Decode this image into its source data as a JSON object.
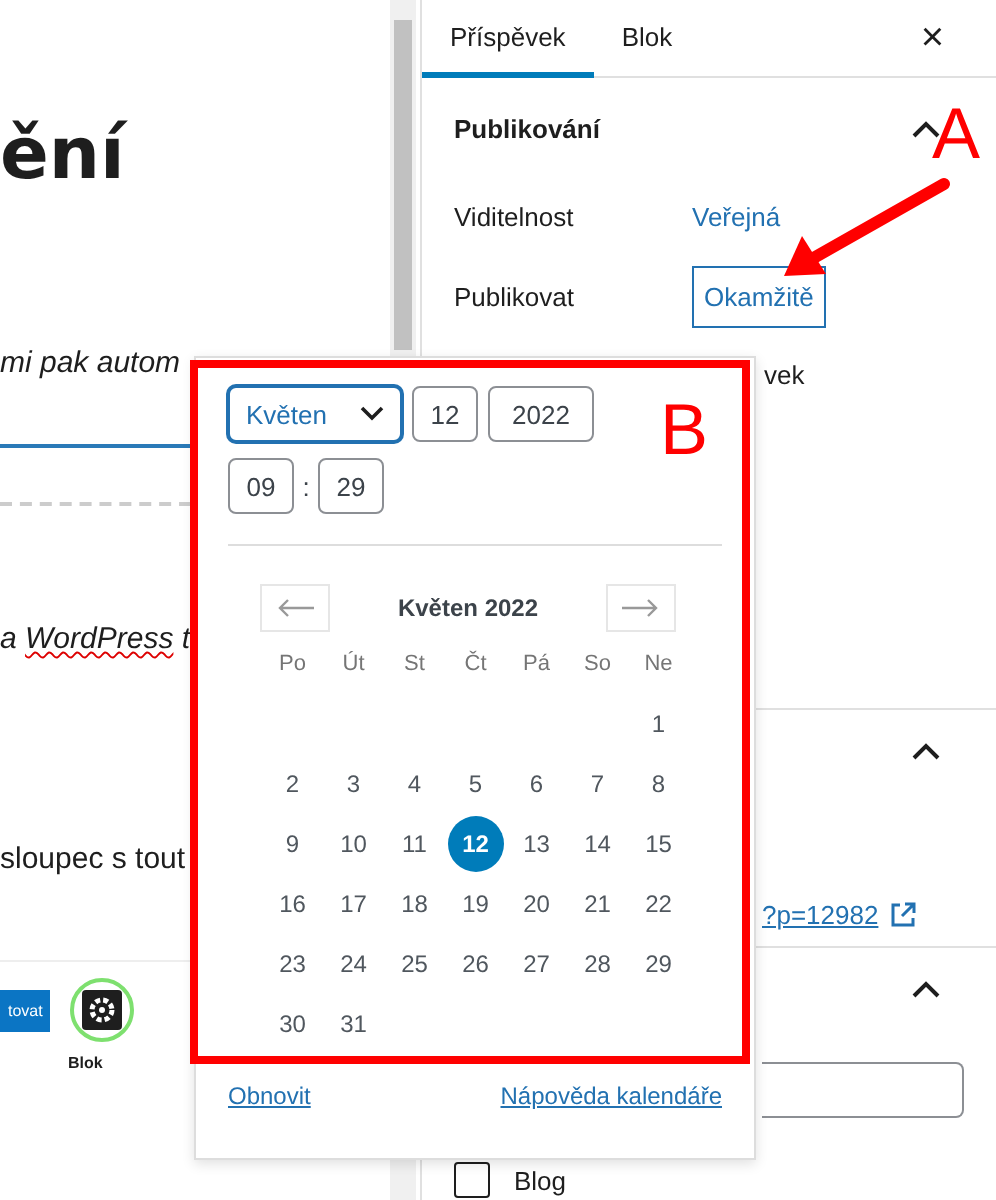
{
  "editor": {
    "heading": "ění",
    "paragraphs": [
      {
        "text": "mi pak autom",
        "kind": "italic"
      },
      {
        "text": "a WordPress t",
        "kind": "misspelled"
      },
      {
        "text": "sloupec s tout",
        "kind": "plain"
      }
    ],
    "embedded": {
      "button": "tovat",
      "tab": "Blok"
    }
  },
  "sidebar": {
    "tabs": [
      {
        "label": "Příspěvek",
        "selected": true
      },
      {
        "label": "Blok",
        "selected": false
      }
    ],
    "close": "×",
    "publish": {
      "title": "Publikování",
      "expanded": true,
      "rows": [
        {
          "label": "Viditelnost",
          "value": "Veřejná",
          "kind": "link"
        },
        {
          "label": "Publikovat",
          "value": "Okamžitě",
          "kind": "button"
        }
      ],
      "partial_text": "vek"
    },
    "permalink": "?p=12982",
    "category": {
      "label": "Blog",
      "checked": false
    }
  },
  "date_picker": {
    "month": "Květen",
    "day": "12",
    "year": "2022",
    "hour": "09",
    "separator": ":",
    "minute": "29",
    "title": "Květen 2022",
    "weekdays": [
      "Po",
      "Út",
      "St",
      "Čt",
      "Pá",
      "So",
      "Ne"
    ],
    "weeks": [
      [
        {
          "day": "1",
          "selected": false
        }
      ],
      [
        {
          "day": "2",
          "selected": false
        },
        {
          "day": "3",
          "selected": false
        },
        {
          "day": "4",
          "selected": false
        },
        {
          "day": "5",
          "selected": false
        },
        {
          "day": "6",
          "selected": false
        },
        {
          "day": "7",
          "selected": false
        },
        {
          "day": "8",
          "selected": false
        }
      ],
      [
        {
          "day": "9",
          "selected": false
        },
        {
          "day": "10",
          "selected": false
        },
        {
          "day": "11",
          "selected": false
        },
        {
          "day": "12",
          "selected": true
        },
        {
          "day": "13",
          "selected": false
        },
        {
          "day": "14",
          "selected": false
        },
        {
          "day": "15",
          "selected": false
        }
      ],
      [
        {
          "day": "16",
          "selected": false
        },
        {
          "day": "17",
          "selected": false
        },
        {
          "day": "18",
          "selected": false
        },
        {
          "day": "19",
          "selected": false
        },
        {
          "day": "20",
          "selected": false
        },
        {
          "day": "21",
          "selected": false
        },
        {
          "day": "22",
          "selected": false
        }
      ],
      [
        {
          "day": "23",
          "selected": false
        },
        {
          "day": "24",
          "selected": false
        },
        {
          "day": "25",
          "selected": false
        },
        {
          "day": "26",
          "selected": false
        },
        {
          "day": "27",
          "selected": false
        },
        {
          "day": "28",
          "selected": false
        },
        {
          "day": "29",
          "selected": false
        }
      ],
      [
        {
          "day": "30",
          "selected": false
        },
        {
          "day": "31",
          "selected": false
        }
      ]
    ],
    "reset": "Obnovit",
    "help": "Nápověda kalendáře"
  },
  "annotations": [
    {
      "label": "A"
    },
    {
      "label": "B"
    }
  ]
}
